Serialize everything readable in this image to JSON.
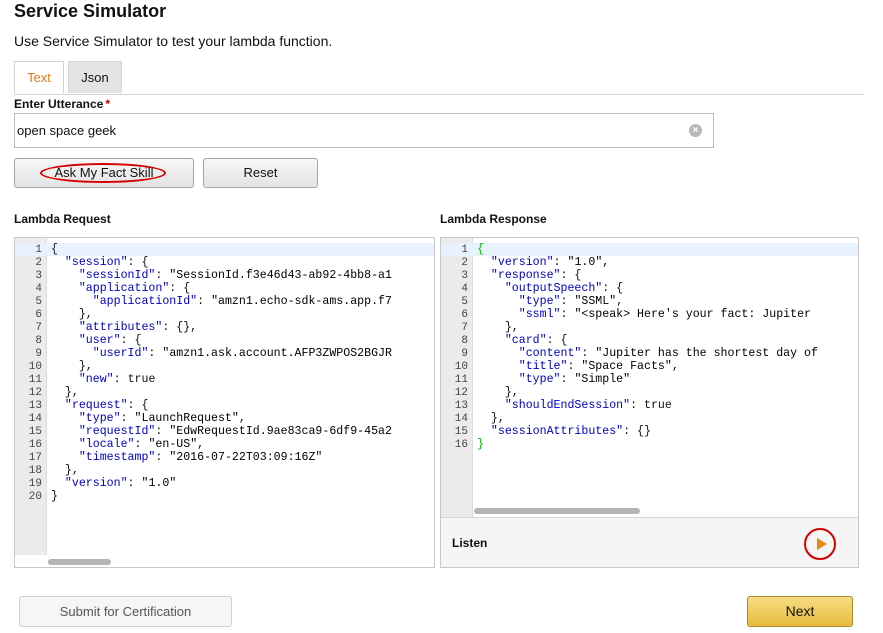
{
  "page": {
    "title": "Service Simulator",
    "subtitle": "Use Service Simulator to test your lambda function."
  },
  "tabs": [
    {
      "label": "Text",
      "active": true
    },
    {
      "label": "Json",
      "active": false
    }
  ],
  "utterance": {
    "label": "Enter Utterance",
    "required_mark": "*",
    "value": "open space geek",
    "clear_icon": "clear-circle-icon"
  },
  "buttons": {
    "ask": "Ask My Fact Skill",
    "reset": "Reset",
    "submit": "Submit for Certification",
    "next": "Next"
  },
  "request": {
    "label": "Lambda Request",
    "lines": [
      "{",
      "  \"session\": {",
      "    \"sessionId\": \"SessionId.f3e46d43-ab92-4bb8-a1",
      "    \"application\": {",
      "      \"applicationId\": \"amzn1.echo-sdk-ams.app.f7",
      "    },",
      "    \"attributes\": {},",
      "    \"user\": {",
      "      \"userId\": \"amzn1.ask.account.AFP3ZWPOS2BGJR",
      "    },",
      "    \"new\": true",
      "  },",
      "  \"request\": {",
      "    \"type\": \"LaunchRequest\",",
      "    \"requestId\": \"EdwRequestId.9ae83ca9-6df9-45a2",
      "    \"locale\": \"en-US\",",
      "    \"timestamp\": \"2016-07-22T03:09:16Z\"",
      "  },",
      "  \"version\": \"1.0\"",
      "}"
    ]
  },
  "response": {
    "label": "Lambda Response",
    "lines": [
      "{",
      "  \"version\": \"1.0\",",
      "  \"response\": {",
      "    \"outputSpeech\": {",
      "      \"type\": \"SSML\",",
      "      \"ssml\": \"<speak> Here's your fact: Jupiter",
      "    },",
      "    \"card\": {",
      "      \"content\": \"Jupiter has the shortest day of",
      "      \"title\": \"Space Facts\",",
      "      \"type\": \"Simple\"",
      "    },",
      "    \"shouldEndSession\": true",
      "  },",
      "  \"sessionAttributes\": {}",
      "}"
    ]
  },
  "listen": {
    "label": "Listen",
    "icon": "play-icon"
  },
  "colors": {
    "active_tab": "#e47911",
    "highlight_ring": "#d40000",
    "next_button": "#e8bc3c",
    "json_key": "#0000c8"
  }
}
